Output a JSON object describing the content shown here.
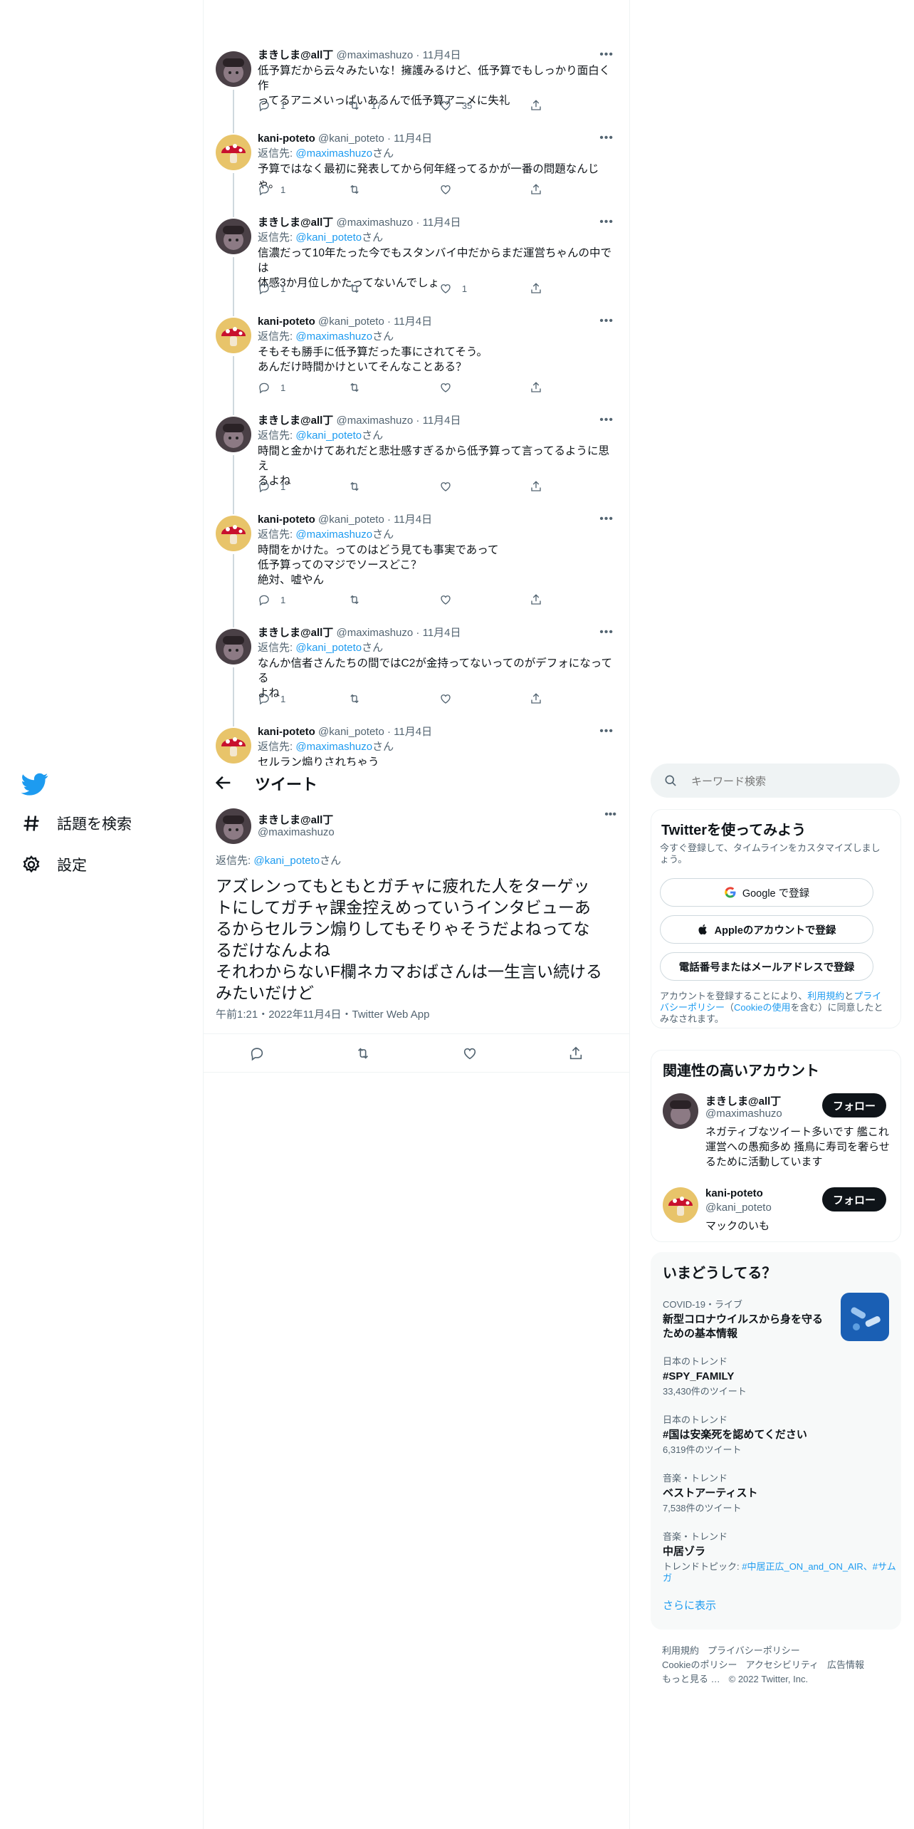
{
  "nav": {
    "items": [
      {
        "label": "話題を検索",
        "icon": "hashtag-icon"
      },
      {
        "label": "設定",
        "icon": "gear-icon"
      }
    ]
  },
  "thread": [
    {
      "name": "まきしま@all丁",
      "handle": "@maximashuzo",
      "time": "11月4日",
      "reply_to": "",
      "body": "低予算だから云々みたいな！擁護みるけど、低予算でもしっかり面白く作\nってるアニメいっぱいあるんで低予算アニメに失礼",
      "replies": "1",
      "retweets": "17",
      "likes": "35"
    },
    {
      "name": "kani-poteto",
      "handle": "@kani_poteto",
      "time": "11月4日",
      "reply_to": "@maximashuzo",
      "body": "予算ではなく最初に発表してから何年経ってるかが一番の問題なんじゃ。",
      "replies": "1",
      "retweets": "",
      "likes": ""
    },
    {
      "name": "まきしま@all丁",
      "handle": "@maximashuzo",
      "time": "11月4日",
      "reply_to": "@kani_poteto",
      "body": "信濃だって10年たった今でもスタンバイ中だからまだ運営ちゃんの中では\n体感3か月位しかたってないんでしょ",
      "replies": "1",
      "retweets": "",
      "likes": "1"
    },
    {
      "name": "kani-poteto",
      "handle": "@kani_poteto",
      "time": "11月4日",
      "reply_to": "@maximashuzo",
      "body": "そもそも勝手に低予算だった事にされてそう。\nあんだけ時間かけといてそんなことある？",
      "replies": "1",
      "retweets": "",
      "likes": ""
    },
    {
      "name": "まきしま@all丁",
      "handle": "@maximashuzo",
      "time": "11月4日",
      "reply_to": "@kani_poteto",
      "body": "時間と金かけてあれだと悲壮感すぎるから低予算って言ってるように思え\nるよね",
      "replies": "1",
      "retweets": "",
      "likes": ""
    },
    {
      "name": "kani-poteto",
      "handle": "@kani_poteto",
      "time": "11月4日",
      "reply_to": "@maximashuzo",
      "body": "時間をかけた。ってのはどう見ても事実であって\n低予算ってのマジでソースどこ？\n絶対、嘘やん",
      "replies": "1",
      "retweets": "",
      "likes": ""
    },
    {
      "name": "まきしま@all丁",
      "handle": "@maximashuzo",
      "time": "11月4日",
      "reply_to": "@kani_poteto",
      "body": "なんか信者さんたちの間ではC2が金持ってないってのがデフォになってる\nよね",
      "replies": "1",
      "retweets": "",
      "likes": ""
    },
    {
      "name": "kani-poteto",
      "handle": "@kani_poteto",
      "time": "11月4日",
      "reply_to": "@maximashuzo",
      "body": "セルラン煽りされちゃう",
      "replies": "",
      "retweets": "",
      "likes": ""
    }
  ],
  "reply_prefix": "返信先: ",
  "reply_suffix": "さん",
  "header": {
    "title": "ツイート"
  },
  "focus": {
    "name": "まきしま@all丁",
    "handle": "@maximashuzo",
    "reply_to_prefix": "返信先: ",
    "reply_to": "@kani_poteto",
    "reply_to_suffix": "さん",
    "body": "アズレンってもともとガチャに疲れた人をターゲッ\nトにしてガチャ課金控えめっていうインタビューあ\nるからセルラン煽りしてもそりゃそうだよねってな\nるだけなんよね\nそれわからないF欄ネカマおばさんは一生言い続ける\nみたいだけど",
    "meta": "午前1:21・2022年11月4日・Twitter Web App"
  },
  "search": {
    "placeholder": "キーワード検索"
  },
  "signup": {
    "title": "Twitterを使ってみよう",
    "subtitle": "今すぐ登録して、タイムラインをカスタマイズしましょう。",
    "google": "Google で登録",
    "apple": "Appleのアカウントで登録",
    "phone": "電話番号またはメールアドレスで登録",
    "terms_1": "アカウントを登録することにより、",
    "terms_link1": "利用規約",
    "terms_2": "と",
    "terms_link2": "プライバシーポリシー",
    "terms_3": "（",
    "terms_link3": "Cookieの使用",
    "terms_4": "を含む）に同意したとみなされます。"
  },
  "relevant": {
    "title": "関連性の高いアカウント",
    "follow_label": "フォロー",
    "accounts": [
      {
        "name": "まきしま@all丁",
        "handle": "@maximashuzo",
        "bio": "ネガティブなツイート多いです 艦これ運営への愚痴多め 搔鳥に寿司を奢らせるために活動しています"
      },
      {
        "name": "kani-poteto",
        "handle": "@kani_poteto",
        "bio": "マックのいも"
      }
    ]
  },
  "trends": {
    "title": "いまどうしてる？",
    "items": [
      {
        "meta": "COVID-19・ライブ",
        "name": "新型コロナウイルスから身を守るための基本情報",
        "count": ""
      },
      {
        "meta": "日本のトレンド",
        "name": "#SPY_FAMILY",
        "count": "33,430件のツイート"
      },
      {
        "meta": "日本のトレンド",
        "name": "#国は安楽死を認めてください",
        "count": "6,319件のツイート"
      },
      {
        "meta": "音楽・トレンド",
        "name": "ベストアーティスト",
        "count": "7,538件のツイート"
      },
      {
        "meta": "音楽・トレンド",
        "name": "中居ゾラ",
        "count_prefix": "トレンドトピック: ",
        "count_link": "#中居正広_ON_and_ON_AIR、#サムガ"
      }
    ],
    "show_more": "さらに表示"
  },
  "footer": {
    "links": [
      "利用規約",
      "プライバシーポリシー",
      "Cookieのポリシー",
      "アクセシビリティ",
      "広告情報"
    ],
    "more": "もっと見る …",
    "copyright": "© 2022 Twitter, Inc."
  },
  "colors": {
    "accent": "#1d9bf0",
    "text": "#0f1419",
    "muted": "#536471"
  }
}
